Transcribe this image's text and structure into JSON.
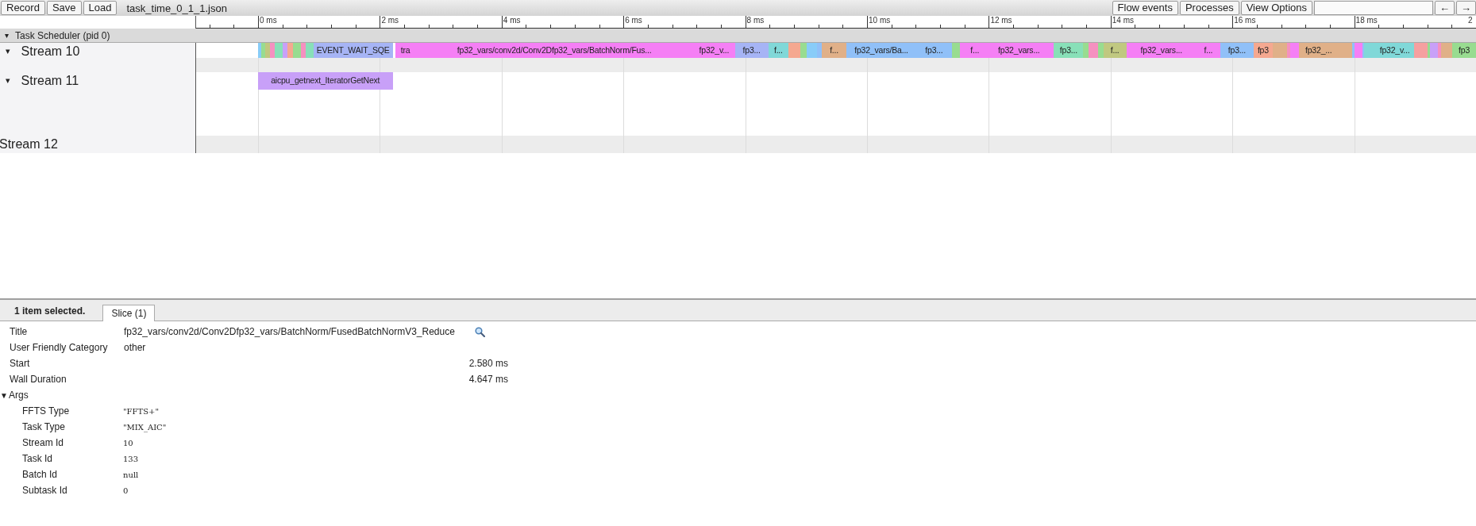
{
  "toolbar": {
    "left_buttons": [
      "Record",
      "Save",
      "Load"
    ],
    "filename": "task_time_0_1_1.json",
    "right_buttons": [
      "Flow events",
      "Processes",
      "View Options"
    ],
    "nav_buttons": [
      "←",
      "→"
    ]
  },
  "ruler": {
    "ticks": [
      "0 ms",
      "2 ms",
      "4 ms",
      "6 ms",
      "8 ms",
      "10 ms",
      "12 ms",
      "14 ms",
      "16 ms",
      "18 ms",
      "2"
    ]
  },
  "process": {
    "toggle": "▾",
    "title": "Task Scheduler (pid 0)"
  },
  "tracks": [
    {
      "toggle": "▾",
      "name": "Stream 10",
      "slices": [
        {
          "color": "#88ccf8"
        },
        {
          "color": "#98dc90"
        },
        {
          "color": "#c0c880"
        },
        {
          "color": "#f590c0"
        },
        {
          "color": "#88e0b8"
        },
        {
          "color": "#c8a0f8"
        },
        {
          "color": "#f5a890"
        },
        {
          "color": "#98dc90"
        },
        {
          "color": "#f590c0"
        },
        {
          "color": "#88e0b8"
        },
        {
          "label": "EVENT_WAIT_SQE",
          "color": "#a6b4f5"
        },
        {
          "label": "tra",
          "color": "#f57ff5"
        },
        {
          "label": "fp32_vars/conv2d/Conv2Dfp32_vars/BatchNorm/Fus...",
          "color": "#f57ff5"
        },
        {
          "label": "fp32_v...",
          "color": "#f57ff5"
        },
        {
          "label": "fp3...",
          "color": "#a6b4f5"
        },
        {
          "label": "f...",
          "color": "#80d8d8"
        },
        {
          "color": "#f5a890"
        },
        {
          "color": "#98dc90"
        },
        {
          "color": "#88ccf8"
        },
        {
          "color": "#90c0f8"
        },
        {
          "label": "f...",
          "color": "#e0b088"
        },
        {
          "label": "fp32_vars/Ba...",
          "color": "#90c0f8"
        },
        {
          "label": "fp3...",
          "color": "#90c0f8"
        },
        {
          "color": "#98dc90"
        },
        {
          "color": "#f57ff5"
        },
        {
          "label": "f...",
          "color": "#f57ff5"
        },
        {
          "label": "fp32_vars...",
          "color": "#f57ff5"
        },
        {
          "label": "fp3...",
          "color": "#88e0b8"
        },
        {
          "color": "#98dc90"
        },
        {
          "color": "#f590c0"
        },
        {
          "color": "#98dc90"
        },
        {
          "label": "f...",
          "color": "#c0c880"
        },
        {
          "label": "fp32_vars...",
          "color": "#f57ff5"
        },
        {
          "label": "f...",
          "color": "#f57ff5"
        },
        {
          "label": "fp3...",
          "color": "#90c0f8"
        },
        {
          "label": "fp3",
          "color": "#f5a890"
        },
        {
          "color": "#e0b088"
        },
        {
          "color": "#f590c0"
        },
        {
          "color": "#f57ff5"
        },
        {
          "label": "fp32_...",
          "color": "#e0b088"
        },
        {
          "color": "#e0b088"
        },
        {
          "color": "#90c0f8"
        },
        {
          "color": "#f57ff5"
        },
        {
          "color": "#90c0f8"
        },
        {
          "color": "#80d8d8"
        },
        {
          "label": "fp32_v...",
          "color": "#80d8d8"
        },
        {
          "color": "#f5a0a0"
        },
        {
          "color": "#98dc90"
        },
        {
          "color": "#c8a0f8"
        },
        {
          "color": "#f590c0"
        },
        {
          "color": "#e0b088"
        },
        {
          "label": "fp3",
          "color": "#98dc90"
        }
      ]
    },
    {
      "toggle": "▾",
      "name": "Stream 11",
      "slices": [
        {
          "label": "aicpu_getnext_IteratorGetNext",
          "color": "#c8a0f8"
        }
      ]
    },
    {
      "name": "Stream 12"
    }
  ],
  "details": {
    "summary": "1 item selected.",
    "tabs": [
      {
        "label": "Slice (1)",
        "selected": true
      }
    ],
    "rows": [
      {
        "kind": "title",
        "label": "Title",
        "value": "fp32_vars/conv2d/Conv2Dfp32_vars/BatchNorm/FusedBatchNormV3_Reduce"
      },
      {
        "kind": "text",
        "label": "User Friendly Category",
        "value": "other"
      },
      {
        "kind": "number",
        "label": "Start",
        "value": "2.580 ms"
      },
      {
        "kind": "number",
        "label": "Wall Duration",
        "value": "4.647 ms"
      }
    ],
    "args": {
      "toggle": "▼",
      "label": "Args",
      "items": [
        {
          "label": "FFTS Type",
          "value": "\"FFTS+\""
        },
        {
          "label": "Task Type",
          "value": "\"MIX_AIC\""
        },
        {
          "label": "Stream Id",
          "value": "10"
        },
        {
          "label": "Task Id",
          "value": "133"
        },
        {
          "label": "Batch Id",
          "value": "null"
        },
        {
          "label": "Subtask Id",
          "value": "0"
        }
      ]
    }
  }
}
